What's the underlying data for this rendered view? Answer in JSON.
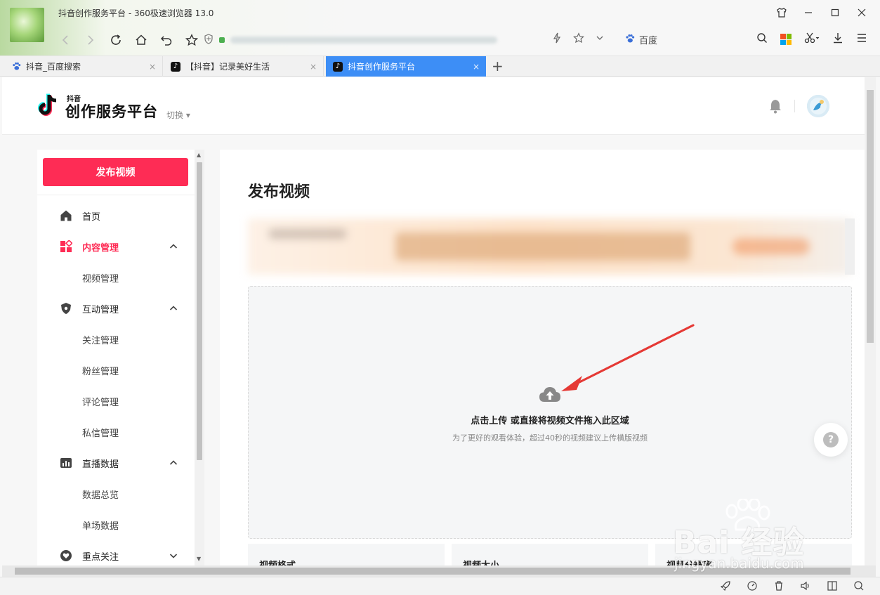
{
  "browser": {
    "window_title": "抖音创作服务平台 - 360极速浏览器 13.0",
    "search_engine": "百度",
    "tabs": [
      {
        "label": "抖音_百度搜索"
      },
      {
        "label": "【抖音】记录美好生活"
      },
      {
        "label": "抖音创作服务平台"
      }
    ],
    "close_glyph": "×",
    "new_tab_glyph": "+"
  },
  "header": {
    "logo_small": "抖音",
    "logo_big": "创作服务平台",
    "switch_label": "切换 ▾"
  },
  "sidebar": {
    "publish_button": "发布视频",
    "items": [
      {
        "label": "首页"
      },
      {
        "label": "内容管理"
      },
      {
        "label": "视频管理"
      },
      {
        "label": "互动管理"
      },
      {
        "label": "关注管理"
      },
      {
        "label": "粉丝管理"
      },
      {
        "label": "评论管理"
      },
      {
        "label": "私信管理"
      },
      {
        "label": "直播数据"
      },
      {
        "label": "数据总览"
      },
      {
        "label": "单场数据"
      },
      {
        "label": "重点关注"
      }
    ]
  },
  "main": {
    "title": "发布视频",
    "upload": {
      "title": "点击上传 或直接将视频文件拖入此区域",
      "hint": "为了更好的观看体验，超过40秒的视频建议上传横版视频"
    },
    "cards": [
      {
        "label": "视频格式"
      },
      {
        "label": "视频大小"
      },
      {
        "label": "视频分辨率"
      }
    ],
    "help": "?"
  },
  "watermark": {
    "brand": "Bai 经验",
    "url": "jingyan.baidu.com"
  },
  "colors": {
    "accent": "#fe2c55",
    "tab_active": "#3d8ef6",
    "annotation": "#e53935"
  }
}
